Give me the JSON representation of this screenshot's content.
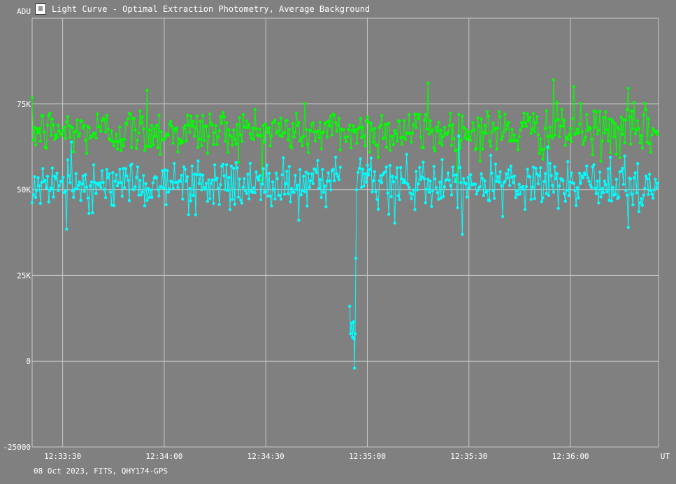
{
  "window": {
    "title": "Light Curve - Optimal Extraction Photometry, Average Background",
    "icon": "light-curve-app-icon"
  },
  "footer": {
    "info": "08 Oct 2023, FITS, QHY174-GPS"
  },
  "colors": {
    "background": "#808080",
    "grid": "#c8c8c8",
    "comparison_star": "#00ff00",
    "target_star": "#00ffff"
  },
  "chart_data": {
    "type": "line",
    "title": "Light Curve - Optimal Extraction Photometry, Average Background",
    "xlabel": "UT",
    "ylabel": "ADU",
    "ylim": [
      -25000,
      100000
    ],
    "yticks": [
      -25000,
      0,
      25000,
      50000,
      75000
    ],
    "ytick_labels": [
      "-25000",
      "0",
      "25K",
      "50K",
      "75K"
    ],
    "xlim": [
      "12:33:21",
      "12:36:26"
    ],
    "xticks": [
      "12:33:30",
      "12:34:00",
      "12:34:30",
      "12:35:00",
      "12:35:30",
      "12:36:00"
    ],
    "xtick_labels": [
      "12:33:30",
      "12:34:00",
      "12:34:30",
      "12:35:00",
      "12:35:30",
      "12:36:00"
    ],
    "grid": true,
    "series": [
      {
        "color": "#00ff00",
        "time_range": [
          "12:33:21",
          "12:36:26"
        ],
        "mean": 67000,
        "noise_sd": 3500,
        "notable_points": [
          {
            "t": "12:33:55",
            "v": 79000
          },
          {
            "t": "12:35:18",
            "v": 81000
          },
          {
            "t": "12:35:55",
            "v": 82000
          },
          {
            "t": "12:36:01",
            "v": 80000
          },
          {
            "t": "12:36:17",
            "v": 79500
          }
        ]
      },
      {
        "color": "#00ffff",
        "time_range": [
          "12:33:21",
          "12:36:26"
        ],
        "mean": 51500,
        "noise_sd": 3500,
        "gap": [
          "12:34:52",
          "12:34:55"
        ],
        "occultation": {
          "start": "12:34:55",
          "end": "12:34:57",
          "points": [
            {
              "t": "12:34:54.8",
              "v": 16000
            },
            {
              "t": "12:34:55.0",
              "v": 8000
            },
            {
              "t": "12:34:55.3",
              "v": 11000
            },
            {
              "t": "12:34:55.6",
              "v": 7000
            },
            {
              "t": "12:34:55.9",
              "v": 11500
            },
            {
              "t": "12:34:56.1",
              "v": 6500
            },
            {
              "t": "12:34:56.2",
              "v": -2000
            },
            {
              "t": "12:34:56.4",
              "v": 8000
            },
            {
              "t": "12:34:56.6",
              "v": 30000
            },
            {
              "t": "12:34:56.8",
              "v": 50000
            }
          ]
        },
        "notable_points": [
          {
            "t": "12:33:31",
            "v": 38500
          },
          {
            "t": "12:35:28",
            "v": 37000
          },
          {
            "t": "12:36:17",
            "v": 39000
          }
        ]
      }
    ]
  }
}
